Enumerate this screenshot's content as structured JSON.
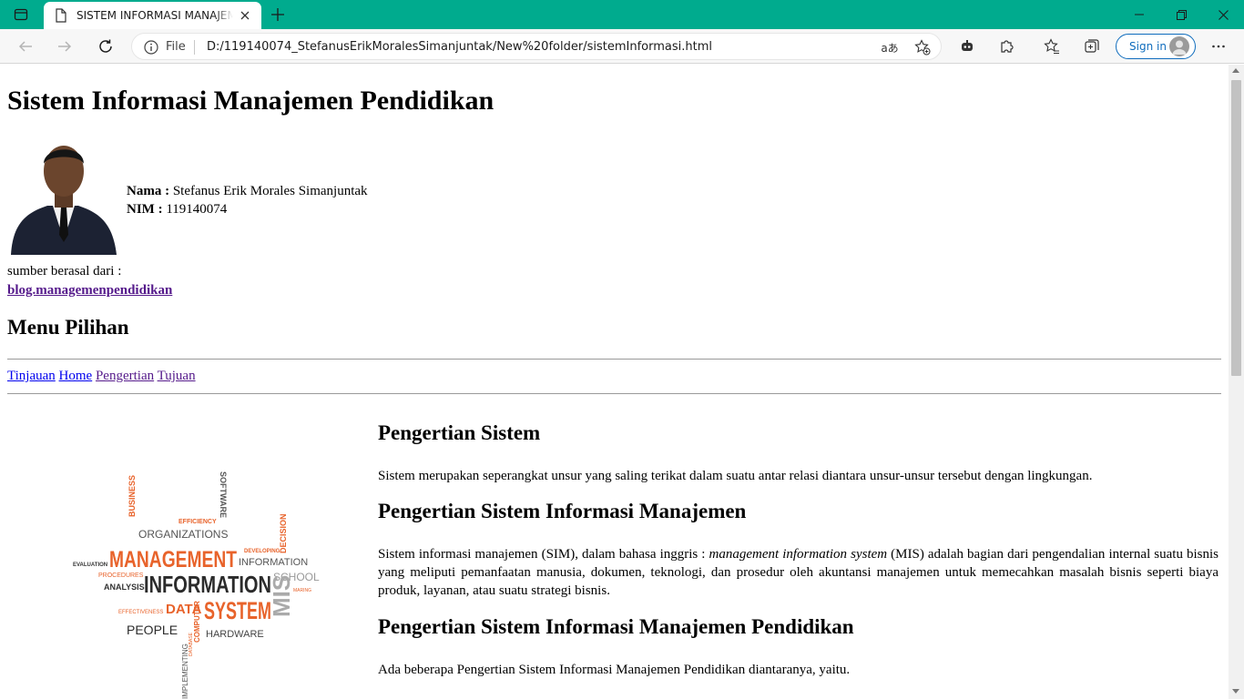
{
  "browser": {
    "tab_title": "SISTEM INFORMASI MANAJEMEN",
    "address_file_label": "File",
    "url": "D:/119140074_StefanusErikMoralesSimanjuntak/New%20folder/sistemInformasi.html",
    "read_aloud_glyph": "aあ",
    "sign_in_label": "Sign in",
    "accent_color": "#00ab8e",
    "icons": [
      "tab-actions-icon",
      "document-icon",
      "close-icon",
      "plus-icon",
      "minimize-icon",
      "restore-icon",
      "close-window-icon",
      "back-icon",
      "forward-icon",
      "refresh-icon",
      "info-icon",
      "read-aloud-icon",
      "add-favorite-icon",
      "extension-games-icon",
      "extensions-icon",
      "favorites-icon",
      "collections-icon",
      "avatar-icon",
      "more-icon"
    ]
  },
  "page": {
    "title": "Sistem Informasi Manajemen Pendidikan",
    "profile": {
      "name_label": "Nama :",
      "name_value": "Stefanus Erik Morales Simanjuntak",
      "nim_label": "NIM :",
      "nim_value": "119140074"
    },
    "source_label": "sumber berasal dari :",
    "source_link": "blog.managemenpendidikan",
    "menu_heading": "Menu Pilihan",
    "nav": [
      "Tinjauan",
      "Home",
      "Pengertian",
      "Tujuan"
    ],
    "wordcloud": {
      "words": [
        "BUSINESS",
        "SOFTWARE",
        "EFFICIENCY",
        "ORGANIZATIONS",
        "DECISION",
        "DEVELOPING",
        "EVALUATION",
        "MANAGEMENT",
        "INFORMATION",
        "PROCEDURES",
        "SCHOOL",
        "ANALYSIS",
        "INFORMATION",
        "MARING",
        "EFFECTIVENESS",
        "DATA",
        "SYSTEM",
        "MIS",
        "PEOPLE",
        "COMPUTER",
        "DATABASE",
        "HARDWARE",
        "IMPLEMENTING"
      ]
    },
    "sections": [
      {
        "heading": "Pengertian Sistem",
        "body": "Sistem merupakan seperangkat unsur yang saling terikat dalam suatu antar relasi diantara unsur-unsur tersebut dengan lingkungan."
      },
      {
        "heading": "Pengertian Sistem Informasi Manajemen",
        "body_pre": "Sistem informasi manajemen (SIM), dalam bahasa inggris : ",
        "body_em": "management information system",
        "body_post": " (MIS) adalah bagian dari pengendalian internal suatu bisnis yang meliputi pemanfaatan manusia, dokumen, teknologi, dan prosedur oleh akuntansi manajemen untuk memecahkan masalah bisnis seperti biaya produk, layanan, atau suatu strategi bisnis."
      },
      {
        "heading": "Pengertian Sistem Informasi Manajemen Pendidikan",
        "body": "Ada beberapa Pengertian Sistem Informasi Manajemen Pendidikan diantaranya, yaitu."
      }
    ]
  }
}
